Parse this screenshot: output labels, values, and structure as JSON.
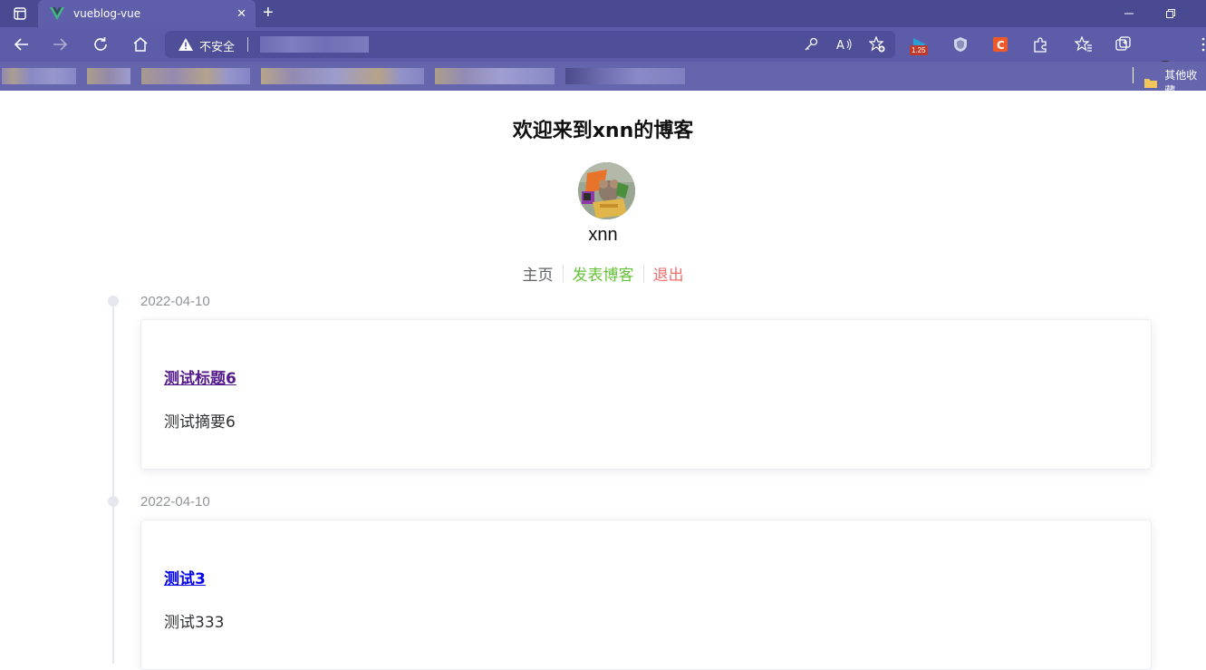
{
  "browser": {
    "tab_title": "vueblog-vue",
    "security_label": "不安全",
    "extension_badge": "1.25",
    "other_bookmarks": "其他收藏"
  },
  "site": {
    "title": "欢迎来到xnn的博客",
    "username": "xnn",
    "menu": {
      "home": "主页",
      "post": "发表博客",
      "logout": "退出"
    }
  },
  "colors": {
    "visited_link": "#551a8b",
    "link": "#0000ee"
  },
  "posts": [
    {
      "date": "2022-04-10",
      "title": "测试标题6",
      "summary": "测试摘要6",
      "visited": true
    },
    {
      "date": "2022-04-10",
      "title": "测试3",
      "summary": "测试333",
      "visited": false
    }
  ]
}
